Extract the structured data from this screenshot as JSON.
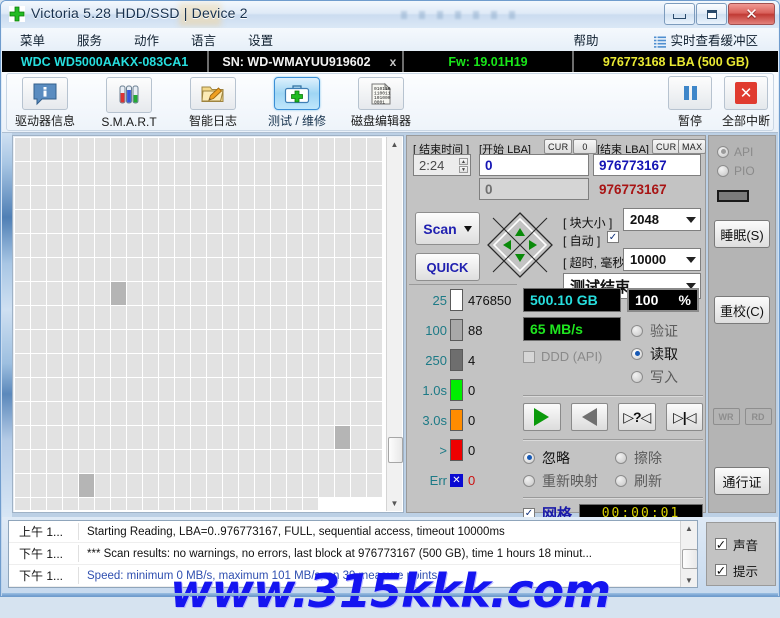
{
  "window": {
    "title": "Victoria 5.28 HDD/SSD | Device 2",
    "icon": "green-cross-icon",
    "minimize": "–",
    "maximize": "□",
    "close": "✕"
  },
  "menu": {
    "items": [
      {
        "label": "菜单",
        "name": "menu-file"
      },
      {
        "label": "服务",
        "name": "menu-service"
      },
      {
        "label": "动作",
        "name": "menu-action"
      },
      {
        "label": "语言",
        "name": "menu-language"
      },
      {
        "label": "设置",
        "name": "menu-settings"
      }
    ],
    "help": "帮助",
    "buffer_view": "实时查看缓冲区"
  },
  "drive_bar": {
    "model": "WDC WD5000AAKX-083CA1",
    "serial": "SN: WD-WMAYUU919602",
    "x_mark": "x",
    "firmware": "Fw: 19.01H19",
    "capacity": "976773168 LBA (500 GB)",
    "colors": {
      "model": "#27dede",
      "serial": "#f2f2f2",
      "firmware": "#19e619",
      "capacity": "#e9e933"
    }
  },
  "toolbar": {
    "buttons": [
      {
        "label": "驱动器信息",
        "icon": "info-bubble-icon",
        "active": false
      },
      {
        "label": "S.M.A.R.T",
        "icon": "test-tubes-icon",
        "active": false
      },
      {
        "label": "智能日志",
        "icon": "folder-pencil-icon",
        "active": false
      },
      {
        "label": "测试 / 维修",
        "icon": "first-aid-kit-icon",
        "active": true
      },
      {
        "label": "磁盘编辑器",
        "icon": "binary-page-icon",
        "active": false
      }
    ],
    "right_buttons": [
      {
        "label": "暂停",
        "icon": "pause-icon"
      },
      {
        "label": "全部中断",
        "icon": "red-x-icon"
      }
    ]
  },
  "scan_params": {
    "end_time_label": "[ 结束时间 ]",
    "end_time_value": "2:24",
    "start_lba_label": "[开始 LBA]",
    "start_lba_cur": "CUR",
    "start_lba_zero": "0",
    "start_lba_value": "0",
    "start_lba_value2": "0",
    "end_lba_label": "[结束 LBA]",
    "end_lba_cur": "CUR",
    "end_lba_max": "MAX",
    "end_lba_value": "976773167",
    "end_lba_value2": "976773167",
    "scan_button": "Scan",
    "quick_button": "QUICK",
    "block_size_label": "[ 块大小 ]",
    "block_size_value": "2048",
    "auto_label": "[ 自动 ]",
    "auto_checked": true,
    "timeout_label": "[ 超时, 毫秒]",
    "timeout_value": "10000",
    "status_combo": "测试结束"
  },
  "stats": {
    "rows": [
      {
        "threshold": "25",
        "color": "#ffffff",
        "count": "476850",
        "name": "stat-25ms"
      },
      {
        "threshold": "100",
        "color": "#a8a8a8",
        "count": "88",
        "name": "stat-100ms"
      },
      {
        "threshold": "250",
        "color": "#6e6e6e",
        "count": "4",
        "name": "stat-250ms"
      },
      {
        "threshold": "1.0s",
        "color": "#00ee00",
        "count": "0",
        "name": "stat-1s"
      },
      {
        "threshold": "3.0s",
        "color": "#ff8c00",
        "count": "0",
        "name": "stat-3s"
      },
      {
        "threshold": ">",
        "color": "#ee0000",
        "count": "0",
        "name": "stat-over"
      }
    ],
    "err_label": "Err",
    "err_count": "0"
  },
  "readout": {
    "capacity": "500.10 GB",
    "percent_value": "100",
    "percent_unit": "%",
    "speed": "65 MB/s",
    "ddd_label": "DDD (API)",
    "ddd_checked": false,
    "modes": [
      {
        "label": "验证",
        "selected": false,
        "name": "mode-verify"
      },
      {
        "label": "读取",
        "selected": true,
        "name": "mode-read"
      },
      {
        "label": "写入",
        "selected": false,
        "name": "mode-write"
      }
    ],
    "nav_buttons": [
      {
        "icon": "play-forward-icon",
        "name": "nav-play"
      },
      {
        "icon": "play-back-icon",
        "name": "nav-back"
      },
      {
        "icon": "jump-query-icon",
        "name": "nav-jump-query"
      },
      {
        "icon": "jump-end-icon",
        "name": "nav-jump-end"
      }
    ],
    "actions": [
      {
        "label": "忽略",
        "selected": true,
        "name": "action-ignore"
      },
      {
        "label": "擦除",
        "selected": false,
        "name": "action-erase"
      },
      {
        "label": "重新映射",
        "selected": false,
        "name": "action-remap"
      },
      {
        "label": "刷新",
        "selected": false,
        "name": "action-refresh"
      }
    ],
    "grid_label": "网格",
    "grid_checked": true,
    "timer": "00:00:01"
  },
  "sidebar": {
    "api_label": "API",
    "api_selected": true,
    "pio_label": "PIO",
    "pio_selected": false,
    "sleep_button": "睡眠(S)",
    "recal_button": "重校(C)",
    "wr_tag": "WR",
    "rd_tag": "RD",
    "pass_button": "通行证"
  },
  "log": {
    "rows": [
      {
        "time": "上午 1...",
        "text": "Starting Reading, LBA=0..976773167, FULL, sequential access, timeout 10000ms",
        "blue": false
      },
      {
        "time": "下午 1...",
        "text": "*** Scan results: no warnings, no errors, last block at 976773167 (500 GB), time 1 hours 18 minut...",
        "blue": false
      },
      {
        "time": "下午 1...",
        "text": "Speed: minimum 0 MB/s, maximum 101 MB/s, on 39 measure points.",
        "blue": true
      }
    ],
    "checks": [
      {
        "label": "声音",
        "checked": true,
        "name": "log-check-sound"
      },
      {
        "label": "提示",
        "checked": true,
        "name": "log-check-hint"
      }
    ]
  },
  "watermark": "www.315kkk.com",
  "block_map": {
    "columns": 23,
    "rows": 16,
    "dark_cells": [
      [
        6,
        6
      ],
      [
        12,
        20
      ],
      [
        14,
        4
      ]
    ],
    "last_row_filled": 19
  }
}
